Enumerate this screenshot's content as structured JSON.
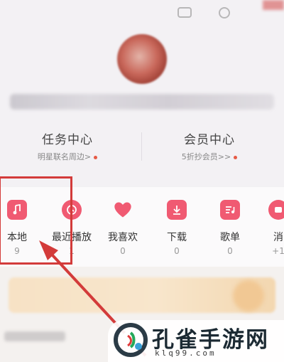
{
  "colors": {
    "accent": "#f05a72",
    "highlight": "#d33b3a",
    "dot": "#e65a45"
  },
  "header": {
    "icons": [
      "message-icon",
      "settings-icon"
    ]
  },
  "cards": [
    {
      "title": "任务中心",
      "subtitle": "明星联名周边>"
    },
    {
      "title": "会员中心",
      "subtitle": "5折抄会员>>"
    }
  ],
  "nav": {
    "items": [
      {
        "label": "本地",
        "count": "9",
        "icon": "music-note-icon"
      },
      {
        "label": "最近播放",
        "count": "1",
        "icon": "clock-icon"
      },
      {
        "label": "我喜欢",
        "count": "0",
        "icon": "heart-icon"
      },
      {
        "label": "下载",
        "count": "0",
        "icon": "download-icon"
      },
      {
        "label": "歌单",
        "count": "0",
        "icon": "playlist-icon"
      },
      {
        "label": "消",
        "count": "+1",
        "icon": "message-icon"
      }
    ]
  },
  "watermark": {
    "name": "孔雀手游网",
    "url": "klq99.com"
  }
}
